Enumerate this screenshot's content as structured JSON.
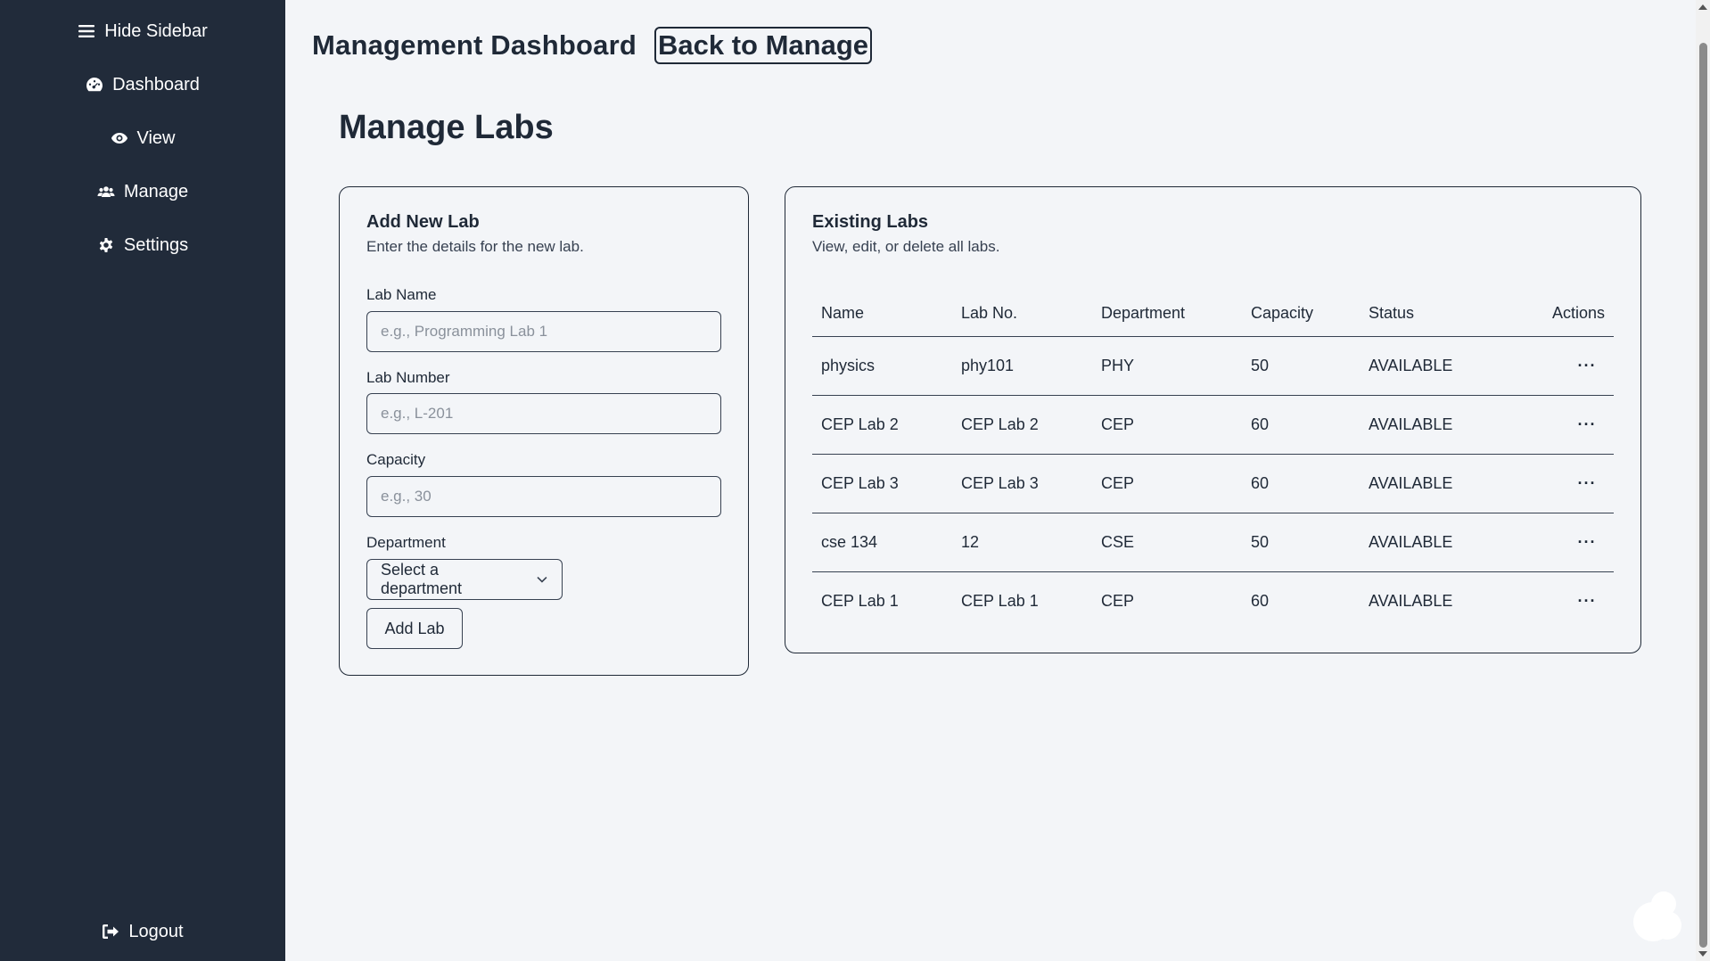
{
  "sidebar": {
    "items": [
      {
        "label": "Hide Sidebar",
        "icon": "menu-icon"
      },
      {
        "label": "Dashboard",
        "icon": "dashboard-icon"
      },
      {
        "label": "View",
        "icon": "eye-icon"
      },
      {
        "label": "Manage",
        "icon": "users-icon"
      },
      {
        "label": "Settings",
        "icon": "gear-icon"
      }
    ],
    "logout": {
      "label": "Logout",
      "icon": "logout-icon"
    }
  },
  "header": {
    "title": "Management Dashboard",
    "back_label": "Back to Manage"
  },
  "page": {
    "title": "Manage Labs"
  },
  "add_form": {
    "title": "Add New Lab",
    "description": "Enter the details for the new lab.",
    "lab_name": {
      "label": "Lab Name",
      "placeholder": "e.g., Programming Lab 1",
      "value": ""
    },
    "lab_number": {
      "label": "Lab Number",
      "placeholder": "e.g., L-201",
      "value": ""
    },
    "capacity": {
      "label": "Capacity",
      "placeholder": "e.g., 30",
      "value": ""
    },
    "department": {
      "label": "Department",
      "selected": "Select a department"
    },
    "submit_label": "Add Lab"
  },
  "labs_table": {
    "title": "Existing Labs",
    "description": "View, edit, or delete all labs.",
    "columns": [
      "Name",
      "Lab No.",
      "Department",
      "Capacity",
      "Status",
      "Actions"
    ],
    "rows": [
      {
        "name": "physics",
        "lab_no": "phy101",
        "department": "PHY",
        "capacity": "50",
        "status": "AVAILABLE",
        "actions": "···"
      },
      {
        "name": "CEP Lab 2",
        "lab_no": "CEP Lab 2",
        "department": "CEP",
        "capacity": "60",
        "status": "AVAILABLE",
        "actions": "···"
      },
      {
        "name": "CEP Lab 3",
        "lab_no": "CEP Lab 3",
        "department": "CEP",
        "capacity": "60",
        "status": "AVAILABLE",
        "actions": "···"
      },
      {
        "name": "cse 134",
        "lab_no": "12",
        "department": "CSE",
        "capacity": "50",
        "status": "AVAILABLE",
        "actions": "···"
      },
      {
        "name": "CEP Lab 1",
        "lab_no": "CEP Lab 1",
        "department": "CEP",
        "capacity": "60",
        "status": "AVAILABLE",
        "actions": "···"
      }
    ]
  },
  "colors": {
    "sidebar_bg": "#212b3a",
    "page_bg": "#f3f5f8",
    "text": "#1f2937",
    "border": "#374151"
  }
}
